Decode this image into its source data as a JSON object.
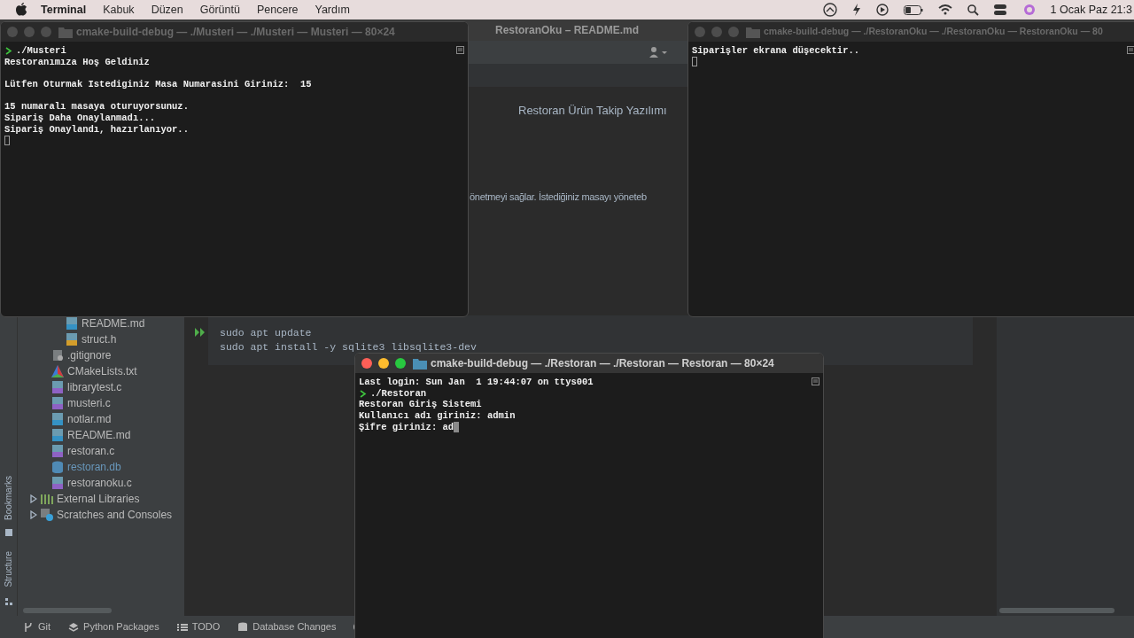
{
  "menubar": {
    "app": "Terminal",
    "menus": [
      "Kabuk",
      "Düzen",
      "Görüntü",
      "Pencere",
      "Yardım"
    ],
    "clock": "1 Ocak Paz 21:3"
  },
  "ide": {
    "title": "RestoranOku – README.md",
    "project_tree": [
      {
        "children": [
          {
            "children": [
              {
                "label": "README.md",
                "kind": "md"
              },
              {
                "label": "struct.h",
                "kind": "h"
              }
            ]
          },
          {
            "label": ".gitignore",
            "kind": "ignore"
          },
          {
            "label": "CMakeLists.txt",
            "kind": "cmake"
          },
          {
            "label": "librarytest.c",
            "kind": "c"
          },
          {
            "label": "musteri.c",
            "kind": "c"
          },
          {
            "label": "notlar.md",
            "kind": "md"
          },
          {
            "label": "README.md",
            "kind": "md"
          },
          {
            "label": "restoran.c",
            "kind": "c"
          },
          {
            "label": "restoran.db",
            "kind": "db"
          },
          {
            "label": "restoranoku.c",
            "kind": "c"
          }
        ]
      },
      {
        "label": "External Libraries",
        "kind": "libraries",
        "expanded": false
      },
      {
        "label": "Scratches and Consoles",
        "kind": "scratches",
        "expanded": false
      }
    ],
    "preview": {
      "heading": "Restoran Ürün Takip Yazılımı",
      "paragraph": "önetmeyi sağlar. İstediğiniz masayı yöneteb",
      "code": [
        "sudo apt update",
        "sudo apt install -y sqlite3 libsqlite3-dev"
      ]
    },
    "side_tools": [
      "Bookmarks",
      "Structure"
    ],
    "bottom_tools": [
      {
        "label": "Git",
        "kind": "git"
      },
      {
        "label": "Python Packages",
        "kind": "packages"
      },
      {
        "label": "TODO",
        "kind": "list"
      },
      {
        "label": "Database Changes",
        "kind": "database"
      }
    ]
  },
  "terminals": [
    {
      "title": "cmake-build-debug — ./Musteri — ./Musteri — Musteri — 80×24",
      "active": false,
      "cursor_inline": false,
      "lines": [
        {
          "kind": "prompt",
          "text": "./Musteri"
        },
        {
          "kind": "output",
          "text": "Restoranımıza Hoş Geldiniz"
        },
        {
          "kind": "blank"
        },
        {
          "kind": "output",
          "text": "Lütfen Oturmak Istediginiz Masa Numarasini Giriniz:  15"
        },
        {
          "kind": "blank"
        },
        {
          "kind": "output",
          "text": "15 numaralı masaya oturuyorsunuz."
        },
        {
          "kind": "output",
          "text": "Sipariş Daha Onaylanmadı..."
        },
        {
          "kind": "output",
          "text": "Sipariş Onaylandı, hazırlanıyor.."
        }
      ]
    },
    {
      "title": "cmake-build-debug — ./RestoranOku — ./RestoranOku — RestoranOku — 80",
      "active": false,
      "cursor_inline": false,
      "lines": [
        {
          "kind": "output",
          "text": "Siparişler ekrana düşecektir.."
        }
      ]
    },
    {
      "title": "cmake-build-debug — ./Restoran — ./Restoran — Restoran — 80×24",
      "active": true,
      "cursor_inline": true,
      "lines": [
        {
          "kind": "output",
          "text": "Last login: Sun Jan  1 19:44:07 on ttys001"
        },
        {
          "kind": "prompt",
          "text": "./Restoran"
        },
        {
          "kind": "output",
          "text": "Restoran Giriş Sistemi"
        },
        {
          "kind": "output",
          "text": "Kullanıcı adı giriniz: admin"
        },
        {
          "kind": "output",
          "text": "Şifre giriniz: ad"
        }
      ]
    }
  ]
}
